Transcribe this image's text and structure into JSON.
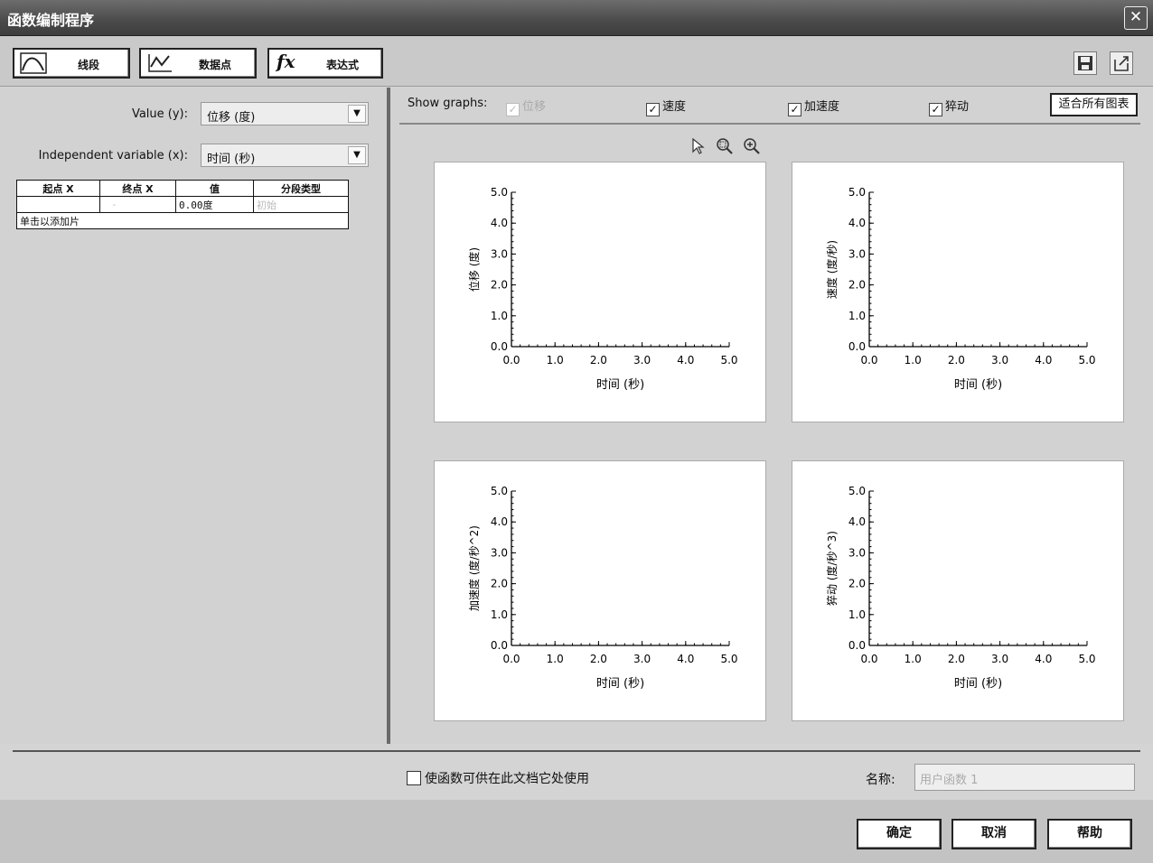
{
  "window": {
    "title": "函数编制程序"
  },
  "toolbar": {
    "buttons": [
      {
        "label": "线段",
        "icon": "segment-curve-icon"
      },
      {
        "label": "数据点",
        "icon": "data-points-icon"
      },
      {
        "label": "表达式",
        "icon": "fx-icon",
        "glyph": "fx"
      }
    ],
    "save_icon": "save-icon",
    "export_icon": "export-icon"
  },
  "form": {
    "value_label": "Value (y):",
    "value_selected": "位移 (度)",
    "independent_label": "Independent variable (x):",
    "independent_selected": "时间 (秒)"
  },
  "segment_table": {
    "headers": [
      "起点 X",
      "终点 X",
      "值",
      "分段类型"
    ],
    "row": {
      "start": "",
      "end": "-",
      "value": "0.00度",
      "type": "初始"
    },
    "add_hint": "单击以添加片"
  },
  "show_graphs": {
    "label": "Show graphs:",
    "options": [
      {
        "label": "位移",
        "checked": true,
        "disabled": true
      },
      {
        "label": "速度",
        "checked": true,
        "disabled": false
      },
      {
        "label": "加速度",
        "checked": true,
        "disabled": false
      },
      {
        "label": "猝动",
        "checked": true,
        "disabled": false
      }
    ],
    "fit_all_label": "适合所有图表"
  },
  "chart_tools": [
    "pointer-icon",
    "zoom-box-icon",
    "zoom-icon"
  ],
  "chart_data": [
    {
      "type": "line",
      "ylabel": "位移 (度)",
      "xlabel": "时间 (秒)",
      "x": [],
      "y": [],
      "xlim": [
        0,
        5
      ],
      "ylim": [
        0,
        5
      ],
      "xticks": [
        "0.0",
        "1.0",
        "2.0",
        "3.0",
        "4.0",
        "5.0"
      ],
      "yticks": [
        "0.0",
        "1.0",
        "2.0",
        "3.0",
        "4.0",
        "5.0"
      ]
    },
    {
      "type": "line",
      "ylabel": "速度 (度/秒)",
      "xlabel": "时间 (秒)",
      "x": [],
      "y": [],
      "xlim": [
        0,
        5
      ],
      "ylim": [
        0,
        5
      ],
      "xticks": [
        "0.0",
        "1.0",
        "2.0",
        "3.0",
        "4.0",
        "5.0"
      ],
      "yticks": [
        "0.0",
        "1.0",
        "2.0",
        "3.0",
        "4.0",
        "5.0"
      ]
    },
    {
      "type": "line",
      "ylabel": "加速度 (度/秒^2)",
      "xlabel": "时间 (秒)",
      "x": [],
      "y": [],
      "xlim": [
        0,
        5
      ],
      "ylim": [
        0,
        5
      ],
      "xticks": [
        "0.0",
        "1.0",
        "2.0",
        "3.0",
        "4.0",
        "5.0"
      ],
      "yticks": [
        "0.0",
        "1.0",
        "2.0",
        "3.0",
        "4.0",
        "5.0"
      ]
    },
    {
      "type": "line",
      "ylabel": "猝动 (度/秒^3)",
      "xlabel": "时间 (秒)",
      "x": [],
      "y": [],
      "xlim": [
        0,
        5
      ],
      "ylim": [
        0,
        5
      ],
      "xticks": [
        "0.0",
        "1.0",
        "2.0",
        "3.0",
        "4.0",
        "5.0"
      ],
      "yticks": [
        "0.0",
        "1.0",
        "2.0",
        "3.0",
        "4.0",
        "5.0"
      ]
    }
  ],
  "bottom": {
    "reuse_label": "使函数可供在此文档它处使用",
    "name_label": "名称:",
    "name_value": "用户函数 1"
  },
  "dialog_buttons": {
    "ok": "确定",
    "cancel": "取消",
    "help": "帮助"
  }
}
